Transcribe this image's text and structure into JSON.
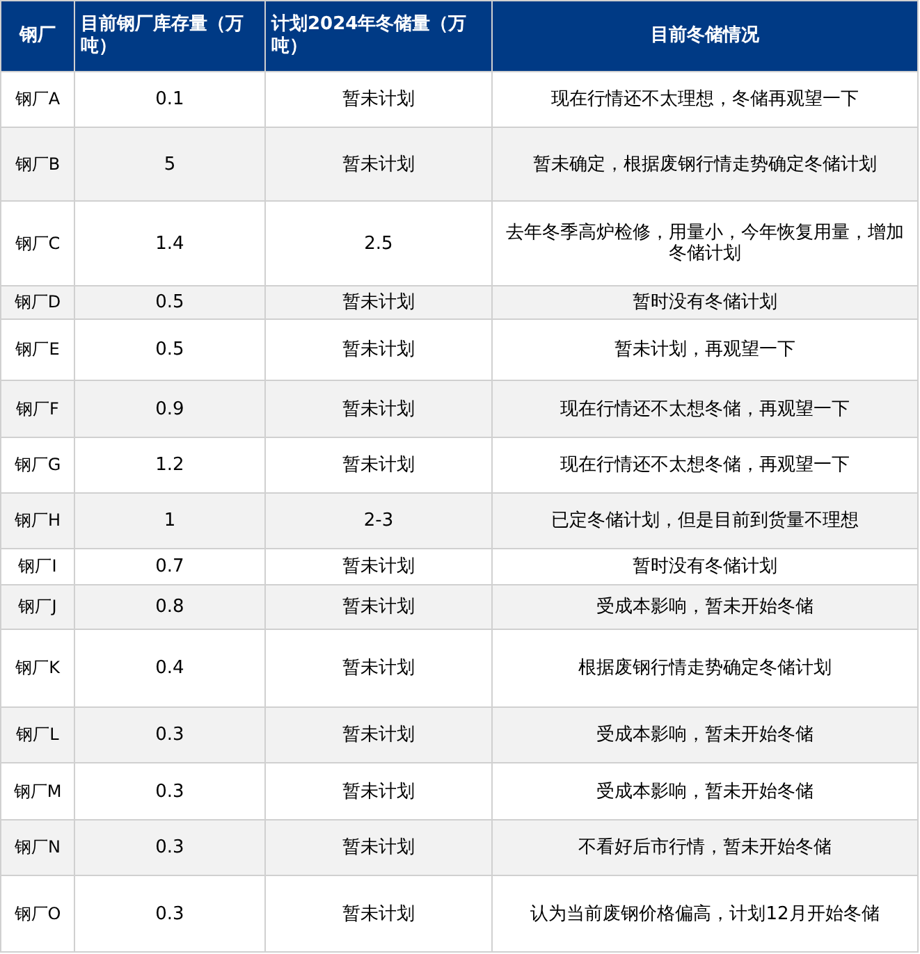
{
  "table": {
    "columns": [
      "钢厂",
      "目前钢厂库存量（万吨）",
      "计划2024年冬储量（万吨）",
      "目前冬储情况"
    ],
    "rows": [
      [
        "钢厂A",
        "0.1",
        "暂未计划",
        "现在行情还不太理想，冬储再观望一下"
      ],
      [
        "钢厂B",
        "5",
        "暂未计划",
        "暂未确定，根据废钢行情走势确定冬储计划"
      ],
      [
        "钢厂C",
        "1.4",
        "2.5",
        "去年冬季高炉检修，用量小，今年恢复用量，增加冬储计划"
      ],
      [
        "钢厂D",
        "0.5",
        "暂未计划",
        "暂时没有冬储计划"
      ],
      [
        "钢厂E",
        "0.5",
        "暂未计划",
        "暂未计划，再观望一下"
      ],
      [
        "钢厂F",
        "0.9",
        "暂未计划",
        "现在行情还不太想冬储，再观望一下"
      ],
      [
        "钢厂G",
        "1.2",
        "暂未计划",
        "现在行情还不太想冬储，再观望一下"
      ],
      [
        "钢厂H",
        "1",
        "2-3",
        "已定冬储计划，但是目前到货量不理想"
      ],
      [
        "钢厂I",
        "0.7",
        "暂未计划",
        "暂时没有冬储计划"
      ],
      [
        "钢厂J",
        "0.8",
        "暂未计划",
        "受成本影响，暂未开始冬储"
      ],
      [
        "钢厂K",
        "0.4",
        "暂未计划",
        "根据废钢行情走势确定冬储计划"
      ],
      [
        "钢厂L",
        "0.3",
        "暂未计划",
        "受成本影响，暂未开始冬储"
      ],
      [
        "钢厂M",
        "0.3",
        "暂未计划",
        "受成本影响，暂未开始冬储"
      ],
      [
        "钢厂N",
        "0.3",
        "暂未计划",
        "不看好后市行情，暂未开始冬储"
      ],
      [
        "钢厂O",
        "0.3",
        "暂未计划",
        "认为当前废钢价格偏高，计划12月开始冬储"
      ]
    ]
  }
}
